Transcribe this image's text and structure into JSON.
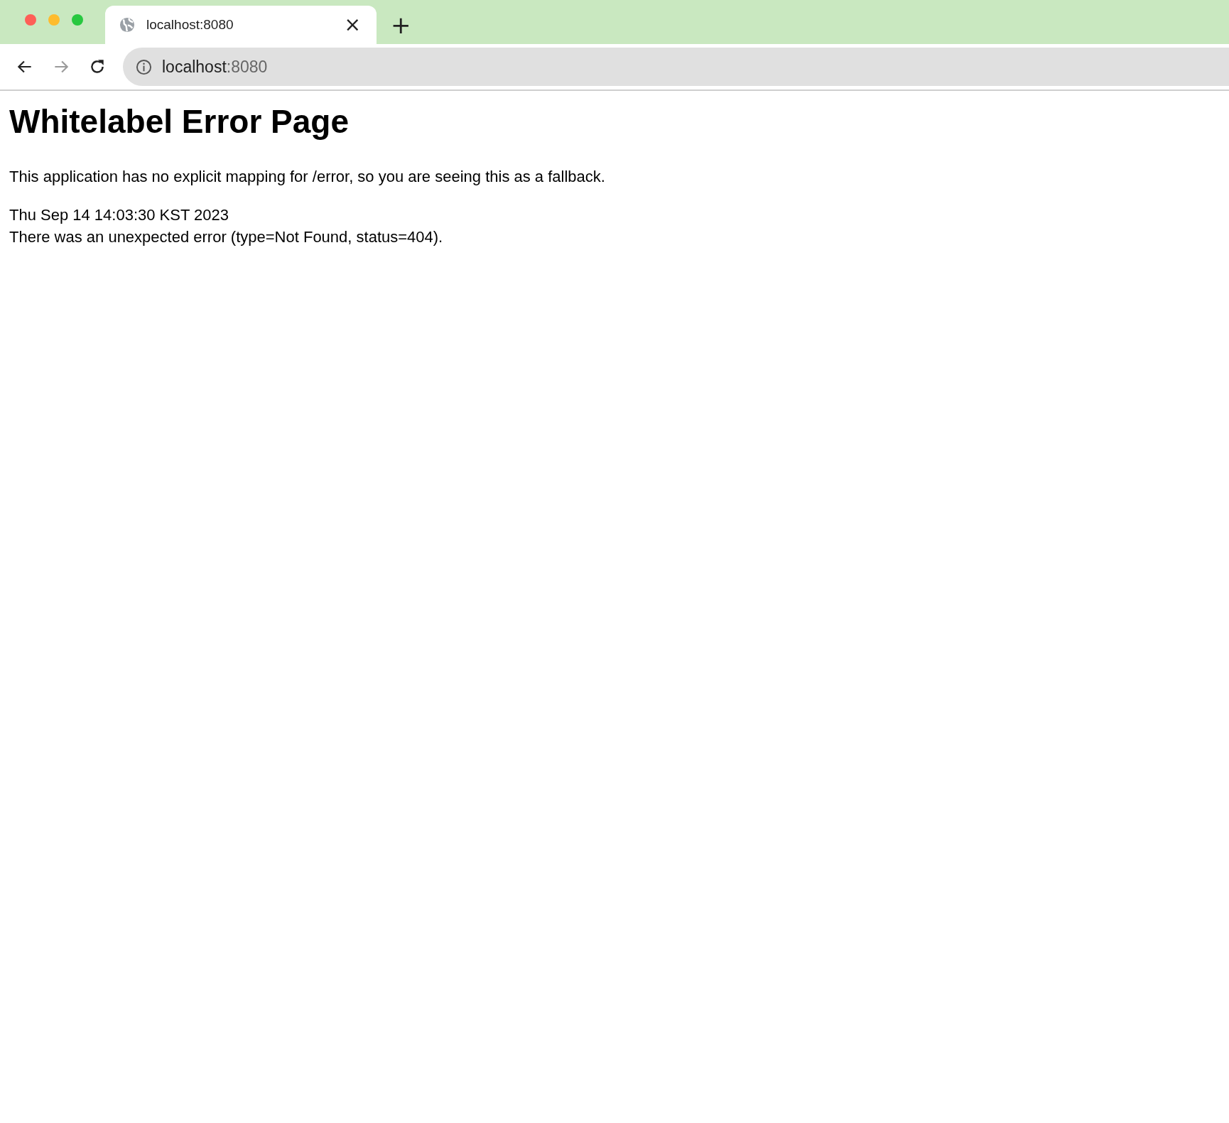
{
  "tabs": [
    {
      "title": "localhost:8080",
      "selected": true,
      "close": "×"
    }
  ],
  "new_tab": "+",
  "address_bar": {
    "host": "localhost",
    "port": ":8080"
  },
  "navigation": {
    "back_enabled": true,
    "forward_enabled": false
  },
  "page": {
    "heading": "Whitelabel Error Page",
    "paragraphs": [
      "This application has no explicit mapping for /error, so you are seeing this as a fallback."
    ],
    "details": [
      "Thu Sep 14 14:03:30 KST 2023",
      "There was an unexpected error (type=Not Found, status=404)."
    ]
  }
}
